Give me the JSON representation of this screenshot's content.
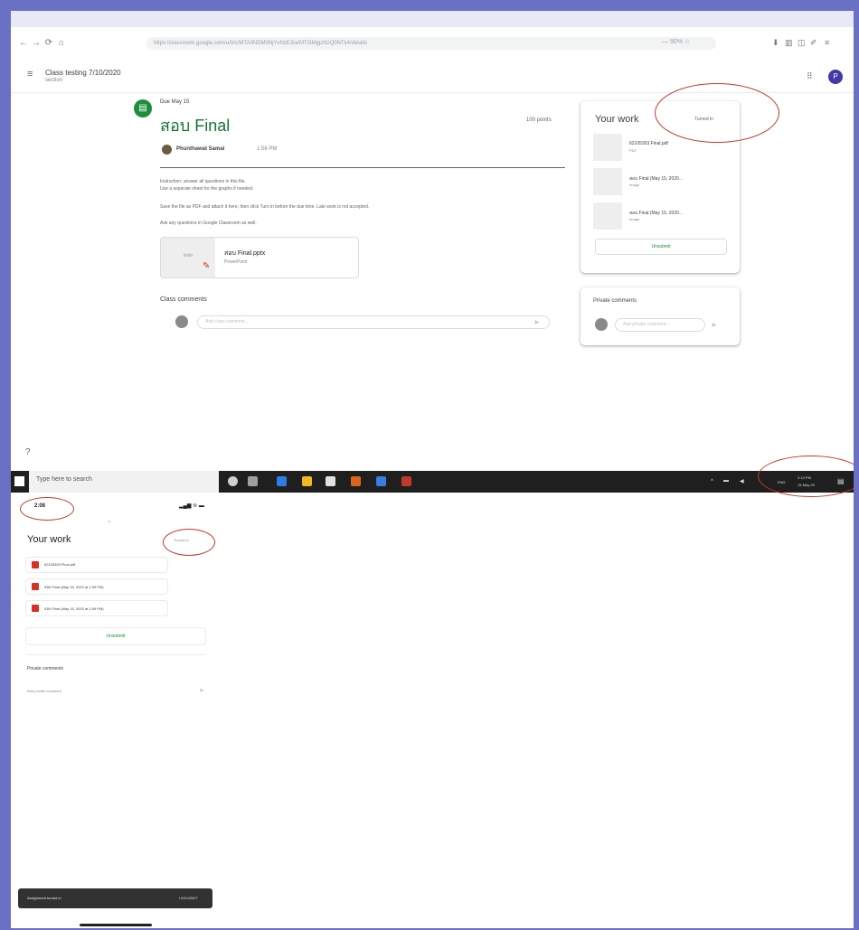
{
  "browser": {
    "url": "https://classroom.google.com/u/0/c/MTA3NDM0NjYxNzE3/a/MTI3MjgzNzQ0NTk4/details",
    "zoom": "— 90% ☆"
  },
  "app": {
    "class_name": "Class testing 7/10/2020",
    "class_section": "section"
  },
  "assignment": {
    "due": "Due May 15",
    "title": "สอบ Final",
    "see_points": "100 points",
    "teacher": "Phunthawat Samai",
    "post_time": "1:56 PM",
    "desc_lines": [
      "Instruction: answer all questions in this file.",
      "Use a separate sheet for the graphs if needed.",
      "Save the file as PDF and attach it here, then click Turn in before the due time. Late work is not accepted.",
      "Ask any questions in Google Classroom as well."
    ],
    "attachment_name": "สอบ Final.pptx",
    "attachment_type": "PowerPoint",
    "attachment_thumb": "slide"
  },
  "class_comments": {
    "title": "Class comments",
    "placeholder": "Add class comment..."
  },
  "your_work": {
    "title": "Your work",
    "status": "Turned in",
    "files": [
      {
        "name": "62105303 Final.pdf",
        "type": "PDF"
      },
      {
        "name": "สอบ Final (May 15, 2020...",
        "type": "Image"
      },
      {
        "name": "สอบ Final (May 15, 2020...",
        "type": "Image"
      }
    ],
    "unsubmit": "Unsubmit"
  },
  "private_comments": {
    "title": "Private comments",
    "placeholder": "Add private comment..."
  },
  "taskbar": {
    "search": "Type here to search",
    "tray_lang": "ENG",
    "tray_time": "2:13 PM",
    "tray_date": "15-May-20"
  },
  "phone": {
    "time": "2:08",
    "status_icons": "▂▄▆ ≋ ▬",
    "your_work": "Your work",
    "status": "Turned in",
    "files": [
      "62105303 Final.pdf",
      "สอบ Final (May 15, 2020 at 1:59 PM)",
      "สอบ Final (May 15, 2020 at 1:59 PM)"
    ],
    "unsubmit": "Unsubmit",
    "private_comments": "Private comments",
    "private_placeholder": "Add private comment",
    "snackbar_text": "Assignment turned in",
    "snackbar_action": "UNSUBMIT"
  },
  "colors": {
    "background": "#6a70c4",
    "classroom_green": "#137333",
    "annotation_red": "#c0392b",
    "taskbar": "#1f1f1f"
  }
}
